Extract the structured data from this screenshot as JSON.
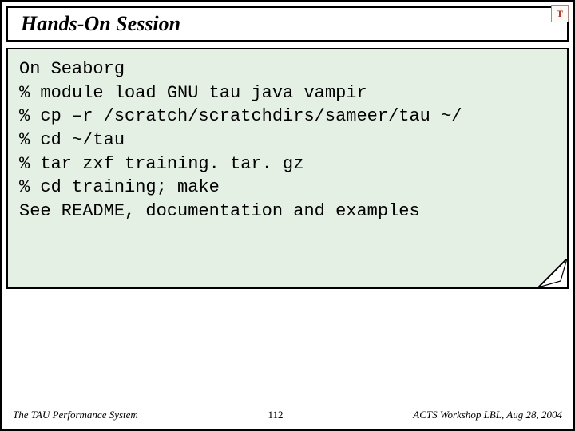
{
  "title": "Hands-On Session",
  "logo_letter": "T",
  "code_lines": [
    "On Seaborg",
    "% module load GNU tau java vampir",
    "% cp –r /scratch/scratchdirs/sameer/tau ~/",
    "% cd ~/tau",
    "% tar zxf training. tar. gz",
    "% cd training; make",
    "See README, documentation and examples"
  ],
  "footer": {
    "left": "The TAU Performance System",
    "center": "112",
    "right": "ACTS Workshop LBL, Aug 28, 2004"
  }
}
